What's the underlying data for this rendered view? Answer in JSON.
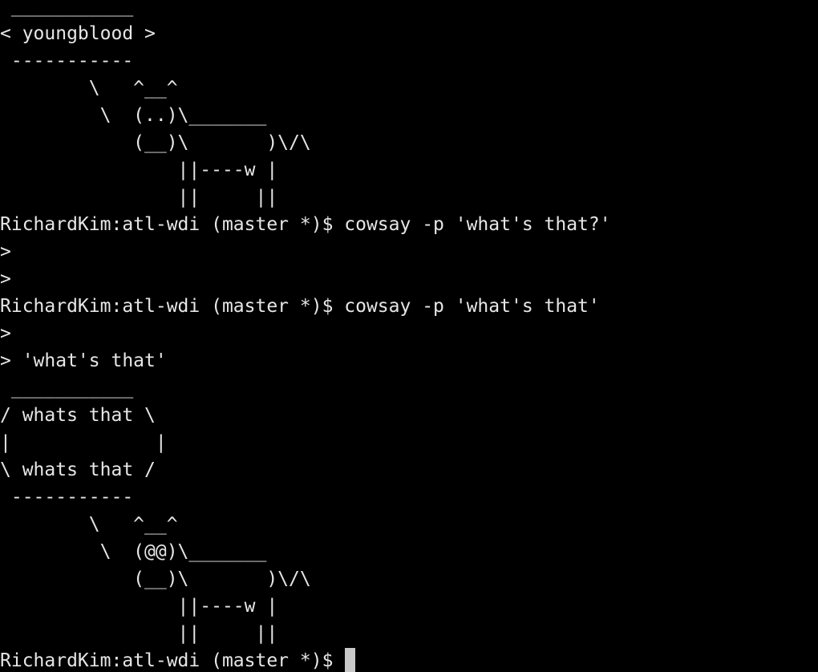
{
  "terminal": {
    "lines": [
      " ___________",
      "< youngblood >",
      " -----------",
      "        \\   ^__^",
      "         \\  (..)\\_______",
      "            (__)\\       )\\/\\",
      "                ||----w |",
      "                ||     ||",
      "RichardKim:atl-wdi (master *)$ cowsay -p 'what's that?'",
      ">",
      ">",
      "RichardKim:atl-wdi (master *)$ cowsay -p 'what's that'",
      ">",
      "> 'what's that'",
      " ___________",
      "/ whats that \\",
      "|             |",
      "\\ whats that /",
      " -----------",
      "        \\   ^__^",
      "         \\  (@@)\\_______",
      "            (__)\\       )\\/\\",
      "                ||----w |",
      "                ||     ||"
    ],
    "prompt": "RichardKim:atl-wdi (master *)$ "
  }
}
